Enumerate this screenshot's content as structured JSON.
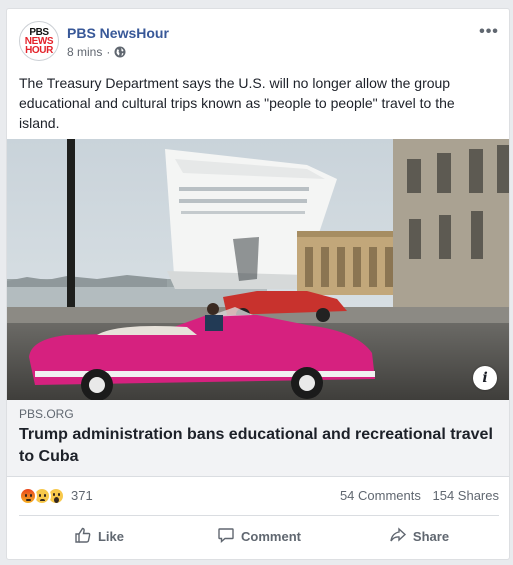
{
  "post": {
    "page_name": "PBS NewsHour",
    "logo_text": [
      "PBS",
      "NEWS",
      "HOUR"
    ],
    "timestamp": "8 mins",
    "separator": "·",
    "audience_icon": "globe-icon",
    "more_label": "•••",
    "text": "The Treasury Department says the U.S. will no longer allow the group educational and cultural trips known as \"people to people\" travel to the island."
  },
  "link": {
    "domain": "PBS.ORG",
    "headline": "Trump administration bans educational and recreational travel to Cuba",
    "info_label": "i"
  },
  "stats": {
    "reaction_icons": [
      "angry-reaction-icon",
      "sad-reaction-icon",
      "wow-reaction-icon"
    ],
    "reaction_count": "371",
    "comments": "54 Comments",
    "shares": "154 Shares"
  },
  "actions": {
    "like": "Like",
    "comment": "Comment",
    "share": "Share"
  },
  "colors": {
    "page_link": "#385898",
    "pink_car": "#d6217f",
    "red_car": "#c8322d"
  }
}
